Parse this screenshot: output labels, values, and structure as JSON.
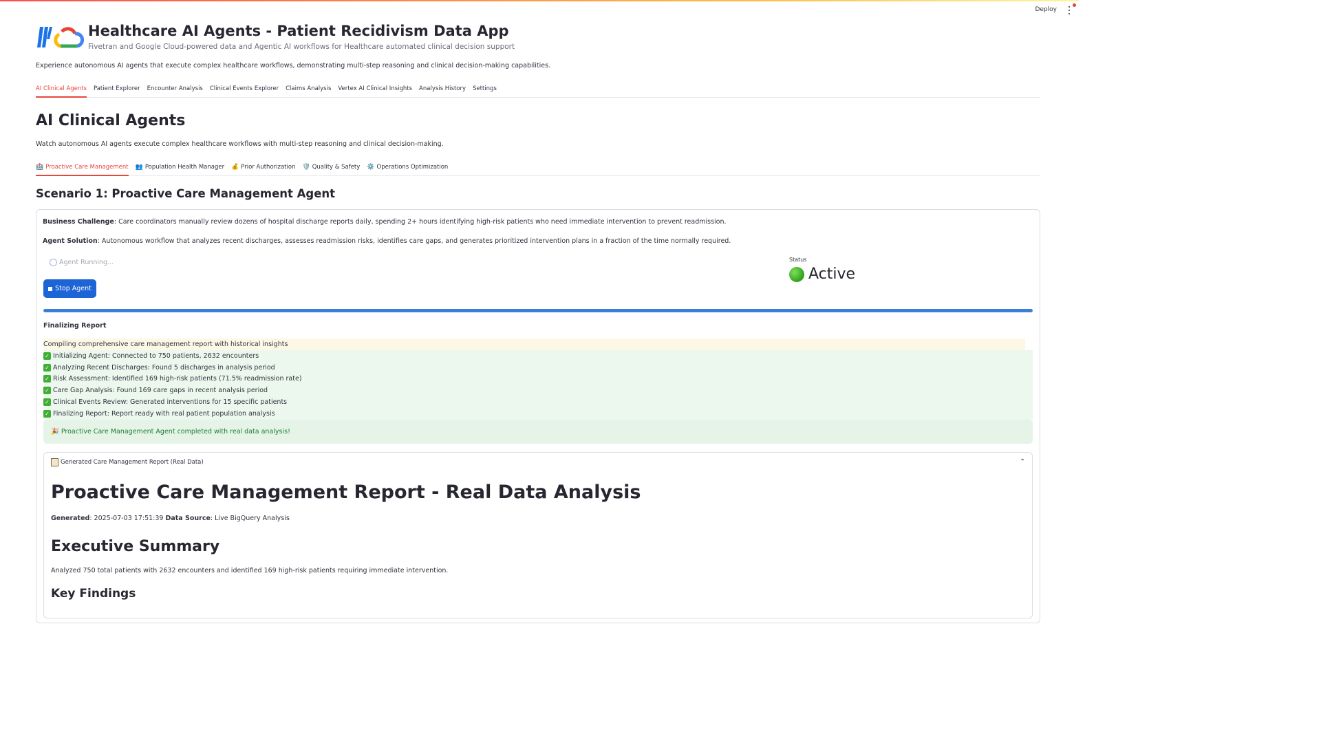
{
  "toolbar": {
    "deploy_label": "Deploy"
  },
  "header": {
    "title": "Healthcare AI Agents - Patient Recidivism Data App",
    "subtitle": "Fivetran and Google Cloud-powered data and Agentic AI workflows for Healthcare automated clinical decision support",
    "intro": "Experience autonomous AI agents that execute complex healthcare workflows, demonstrating multi-step reasoning and clinical decision-making capabilities."
  },
  "main_tabs": [
    "AI Clinical Agents",
    "Patient Explorer",
    "Encounter Analysis",
    "Clinical Events Explorer",
    "Claims Analysis",
    "Vertex AI Clinical Insights",
    "Analysis History",
    "Settings"
  ],
  "agents": {
    "heading": "AI Clinical Agents",
    "description": "Watch autonomous AI agents execute complex healthcare workflows with multi-step reasoning and clinical decision-making."
  },
  "sub_tabs": [
    {
      "icon": "🏥",
      "label": "Proactive Care Management"
    },
    {
      "icon": "👥",
      "label": "Population Health Manager"
    },
    {
      "icon": "💰",
      "label": "Prior Authorization"
    },
    {
      "icon": "🛡️",
      "label": "Quality & Safety"
    },
    {
      "icon": "⚙️",
      "label": "Operations Optimization"
    }
  ],
  "scenario": {
    "title": "Scenario 1: Proactive Care Management Agent",
    "challenge_label": "Business Challenge",
    "challenge_text": ": Care coordinators manually review dozens of hospital discharge reports daily, spending 2+ hours identifying high-risk patients who need immediate intervention to prevent readmission.",
    "solution_label": "Agent Solution",
    "solution_text": ": Autonomous workflow that analyzes recent discharges, assesses readmission risks, identifies care gaps, and generates prioritized intervention plans in a fraction of the time normally required.",
    "running_label": "Agent Running...",
    "stop_label": "Stop Agent",
    "status_label": "Status",
    "status_value": "Active",
    "progress": 1.0,
    "stage": "Finalizing Report",
    "current_status": "Compiling comprehensive care management report with historical insights",
    "steps": [
      "Initializing Agent: Connected to 750 patients, 2632 encounters",
      "Analyzing Recent Discharges: Found 5 discharges in analysis period",
      "Risk Assessment: Identified 169 high-risk patients (71.5% readmission rate)",
      "Care Gap Analysis: Found 169 care gaps in recent analysis period",
      "Clinical Events Review: Generated interventions for 15 specific patients",
      "Finalizing Report: Report ready with real patient population analysis"
    ],
    "success_icon": "🎉",
    "success_message": "Proactive Care Management Agent completed with real data analysis!"
  },
  "report": {
    "expander_label": "Generated Care Management Report (Real Data)",
    "title": "Proactive Care Management Report - Real Data Analysis",
    "generated_label": "Generated",
    "generated_value": ": 2025-07-03 17:51:39 ",
    "source_label": "Data Source",
    "source_value": ": Live BigQuery Analysis",
    "exec_heading": "Executive Summary",
    "exec_text": "Analyzed 750 total patients with 2632 encounters and identified 169 high-risk patients requiring immediate intervention.",
    "key_heading": "Key Findings"
  },
  "colors": {
    "accent_red": "#e8453c",
    "primary_blue": "#1d64d6",
    "progress_blue": "#3b7ed5",
    "success_green": "#1d7c31"
  }
}
